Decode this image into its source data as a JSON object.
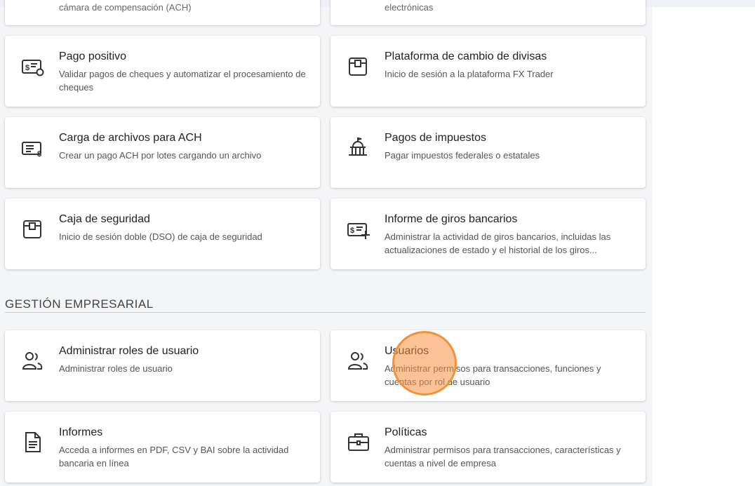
{
  "cards_top_partial": [
    {
      "desc": "cámara de compensación (ACH)"
    },
    {
      "desc": "electrónicas"
    }
  ],
  "cards": [
    {
      "title": "Pago positivo",
      "desc": "Validar pagos de cheques y automatizar el procesamiento de cheques",
      "icon": "check-payment-icon"
    },
    {
      "title": "Plataforma de cambio de divisas",
      "desc": "Inicio de sesión a la plataforma FX Trader",
      "icon": "box-icon"
    },
    {
      "title": "Carga de archivos para ACH",
      "desc": "Crear un pago ACH por lotes cargando un archivo",
      "icon": "ach-file-icon"
    },
    {
      "title": "Pagos de impuestos",
      "desc": "Pagar impuestos federales o estatales",
      "icon": "government-building-icon"
    },
    {
      "title": "Caja de seguridad",
      "desc": "Inicio de sesión doble (DSO) de caja de seguridad",
      "icon": "box-icon"
    },
    {
      "title": "Informe de giros bancarios",
      "desc": "Administrar la actividad de giros bancarios, incluidas las actualizaciones de estado y el historial de los giros...",
      "icon": "wire-transfer-icon"
    }
  ],
  "section": {
    "title": "GESTIÓN EMPRESARIAL"
  },
  "cards_mgmt": [
    {
      "title": "Administrar roles de usuario",
      "desc": "Administrar roles de usuario",
      "icon": "users-icon"
    },
    {
      "title": "Usuarios",
      "desc": "Administrar permisos para transacciones, funciones y cuentas por rol de usuario",
      "icon": "users-icon"
    },
    {
      "title": "Informes",
      "desc": "Acceda a informes en PDF, CSV y BAI sobre la actividad bancaria en línea",
      "icon": "report-document-icon"
    },
    {
      "title": "Políticas",
      "desc": "Administrar permisos para transacciones, características y cuentas a nivel de empresa",
      "icon": "briefcase-icon"
    }
  ]
}
